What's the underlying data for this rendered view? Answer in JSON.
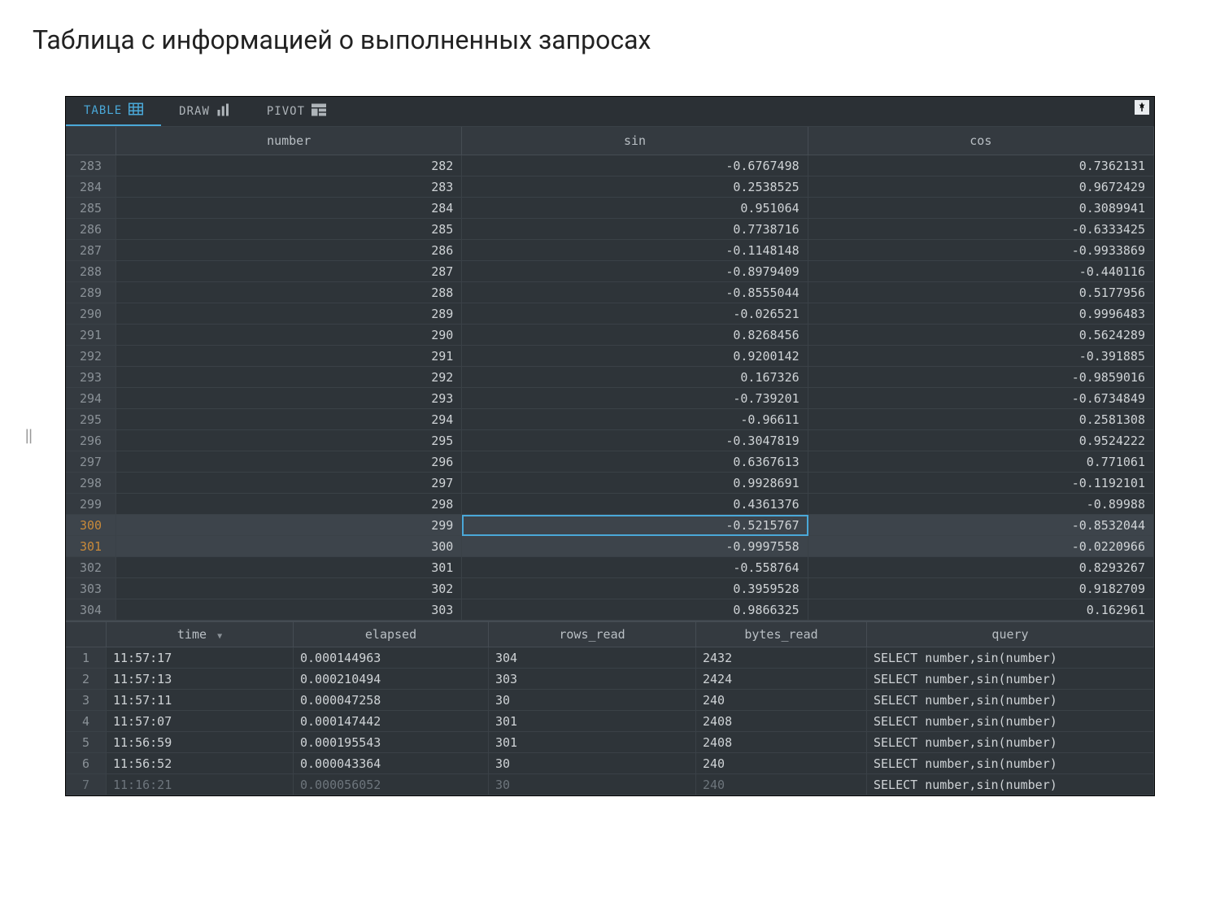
{
  "page_title": "Таблица с информацией о выполненных запросах",
  "tabs": {
    "table": "TABLE",
    "draw": "DRAW",
    "pivot": "PIVOT"
  },
  "grid": {
    "headers": [
      "",
      "number",
      "sin",
      "cos"
    ],
    "rows": [
      {
        "idx": "283",
        "number": "282",
        "sin": "-0.6767498",
        "cos": "0.7362131"
      },
      {
        "idx": "284",
        "number": "283",
        "sin": "0.2538525",
        "cos": "0.9672429"
      },
      {
        "idx": "285",
        "number": "284",
        "sin": "0.951064",
        "cos": "0.3089941"
      },
      {
        "idx": "286",
        "number": "285",
        "sin": "0.7738716",
        "cos": "-0.6333425"
      },
      {
        "idx": "287",
        "number": "286",
        "sin": "-0.1148148",
        "cos": "-0.9933869"
      },
      {
        "idx": "288",
        "number": "287",
        "sin": "-0.8979409",
        "cos": "-0.440116"
      },
      {
        "idx": "289",
        "number": "288",
        "sin": "-0.8555044",
        "cos": "0.5177956"
      },
      {
        "idx": "290",
        "number": "289",
        "sin": "-0.026521",
        "cos": "0.9996483"
      },
      {
        "idx": "291",
        "number": "290",
        "sin": "0.8268456",
        "cos": "0.5624289"
      },
      {
        "idx": "292",
        "number": "291",
        "sin": "0.9200142",
        "cos": "-0.391885"
      },
      {
        "idx": "293",
        "number": "292",
        "sin": "0.167326",
        "cos": "-0.9859016"
      },
      {
        "idx": "294",
        "number": "293",
        "sin": "-0.739201",
        "cos": "-0.6734849"
      },
      {
        "idx": "295",
        "number": "294",
        "sin": "-0.96611",
        "cos": "0.2581308"
      },
      {
        "idx": "296",
        "number": "295",
        "sin": "-0.3047819",
        "cos": "0.9524222"
      },
      {
        "idx": "297",
        "number": "296",
        "sin": "0.6367613",
        "cos": "0.771061"
      },
      {
        "idx": "298",
        "number": "297",
        "sin": "0.9928691",
        "cos": "-0.1192101"
      },
      {
        "idx": "299",
        "number": "298",
        "sin": "0.4361376",
        "cos": "-0.89988"
      },
      {
        "idx": "300",
        "number": "299",
        "sin": "-0.5215767",
        "cos": "-0.8532044",
        "selected": true,
        "cellSelected": true
      },
      {
        "idx": "301",
        "number": "300",
        "sin": "-0.9997558",
        "cos": "-0.0220966",
        "selected": true
      },
      {
        "idx": "302",
        "number": "301",
        "sin": "-0.558764",
        "cos": "0.8293267"
      },
      {
        "idx": "303",
        "number": "302",
        "sin": "0.3959528",
        "cos": "0.9182709"
      },
      {
        "idx": "304",
        "number": "303",
        "sin": "0.9866325",
        "cos": "0.162961"
      }
    ]
  },
  "log": {
    "headers": [
      "",
      "time",
      "elapsed",
      "rows_read",
      "bytes_read",
      "query"
    ],
    "sort_indicator": "▼",
    "rows": [
      {
        "idx": "1",
        "time": "11:57:17",
        "elapsed": "0.000144963",
        "rows_read": "304",
        "bytes_read": "2432",
        "query": "SELECT number,sin(number)"
      },
      {
        "idx": "2",
        "time": "11:57:13",
        "elapsed": "0.000210494",
        "rows_read": "303",
        "bytes_read": "2424",
        "query": "SELECT number,sin(number)"
      },
      {
        "idx": "3",
        "time": "11:57:11",
        "elapsed": "0.000047258",
        "rows_read": "30",
        "bytes_read": "240",
        "query": "SELECT number,sin(number)"
      },
      {
        "idx": "4",
        "time": "11:57:07",
        "elapsed": "0.000147442",
        "rows_read": "301",
        "bytes_read": "2408",
        "query": "SELECT number,sin(number)"
      },
      {
        "idx": "5",
        "time": "11:56:59",
        "elapsed": "0.000195543",
        "rows_read": "301",
        "bytes_read": "2408",
        "query": "SELECT number,sin(number)"
      },
      {
        "idx": "6",
        "time": "11:56:52",
        "elapsed": "0.000043364",
        "rows_read": "30",
        "bytes_read": "240",
        "query": "SELECT number,sin(number)"
      },
      {
        "idx": "7",
        "time": "11:16:21",
        "elapsed": "0.000056052",
        "rows_read": "30",
        "bytes_read": "240",
        "query": "SELECT number,sin(number)",
        "cut": true
      }
    ]
  }
}
